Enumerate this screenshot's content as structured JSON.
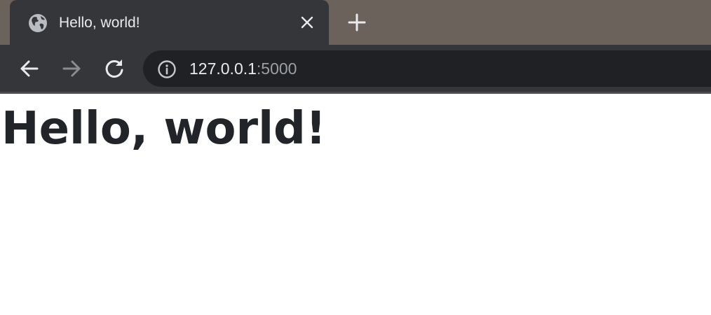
{
  "browser": {
    "tab": {
      "title": "Hello, world!",
      "favicon": "globe-icon"
    },
    "new_tab_icon": "plus-icon",
    "close_icon": "close-icon",
    "nav": {
      "back_icon": "arrow-left-icon",
      "forward_icon": "arrow-right-icon",
      "reload_icon": "reload-icon"
    },
    "address_bar": {
      "site_info_icon": "info-icon",
      "url_host": "127.0.0.1",
      "url_port": ":5000"
    }
  },
  "page": {
    "heading": "Hello, world!"
  },
  "colors": {
    "tabstrip_background": "#6b625b",
    "toolbar_background": "#35363a",
    "omnibox_background": "#202124",
    "heading_text": "#212529"
  }
}
